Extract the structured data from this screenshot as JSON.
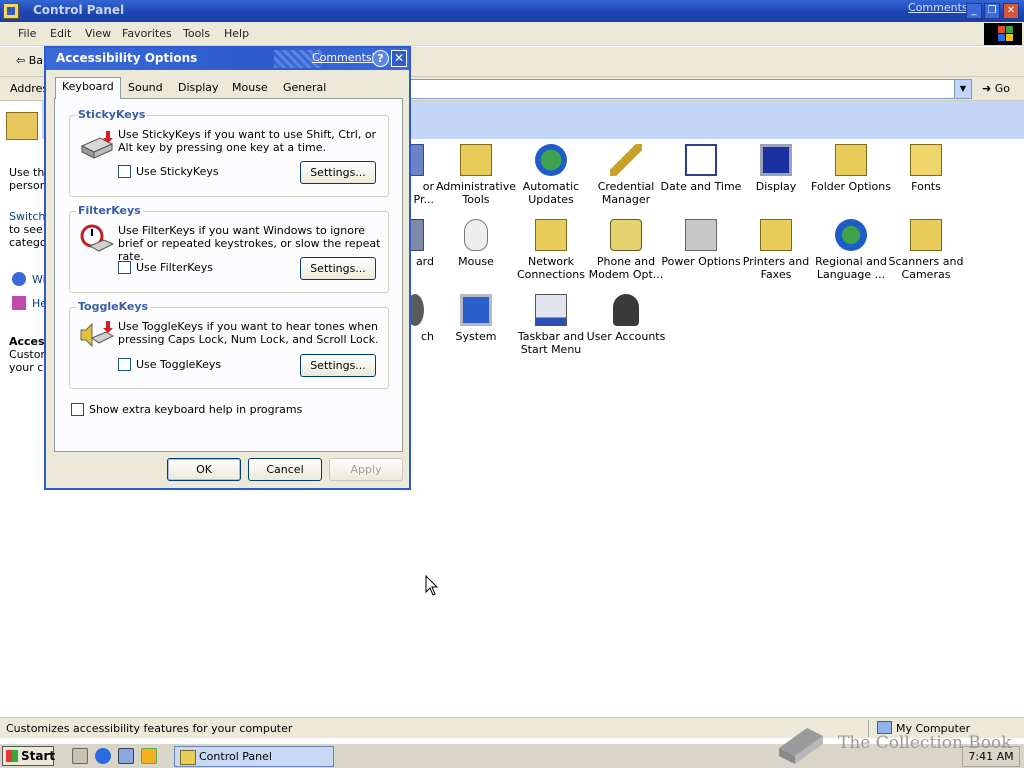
{
  "main_window": {
    "title": "Control Panel",
    "comments_link": "Comments?",
    "minimize": "_",
    "restore": "❐",
    "close": "✕"
  },
  "menu": [
    "File",
    "Edit",
    "View",
    "Favorites",
    "Tools",
    "Help"
  ],
  "toolbar": {
    "back_label": "Ba"
  },
  "address": {
    "label": "Addres",
    "go_label": "Go"
  },
  "left_panel": {
    "line1": "Use the",
    "line2": "person",
    "switch": "Switch",
    "to_see": "to see i",
    "category": "categor",
    "item1": "Wi",
    "item2": "He",
    "access_title": "Acces",
    "custom": "Custom",
    "your": "your co"
  },
  "icons_row1": [
    {
      "l1": "or",
      "l2": "Pr...",
      "name": "cut-off"
    },
    {
      "l1": "Administrative",
      "l2": "Tools"
    },
    {
      "l1": "Automatic",
      "l2": "Updates"
    },
    {
      "l1": "Credential",
      "l2": "Manager"
    },
    {
      "l1": "Date and Time",
      "l2": ""
    },
    {
      "l1": "Display",
      "l2": ""
    },
    {
      "l1": "Folder Options",
      "l2": ""
    },
    {
      "l1": "Fonts",
      "l2": ""
    }
  ],
  "icons_row2": [
    {
      "l1": "ard",
      "l2": ""
    },
    {
      "l1": "Mouse",
      "l2": ""
    },
    {
      "l1": "Network",
      "l2": "Connections"
    },
    {
      "l1": "Phone and",
      "l2": "Modem Opt..."
    },
    {
      "l1": "Power Options",
      "l2": ""
    },
    {
      "l1": "Printers and",
      "l2": "Faxes"
    },
    {
      "l1": "Regional and",
      "l2": "Language ..."
    },
    {
      "l1": "Scanners and",
      "l2": "Cameras"
    }
  ],
  "icons_row3": [
    {
      "l1": "ch",
      "l2": ""
    },
    {
      "l1": "System",
      "l2": ""
    },
    {
      "l1": "Taskbar and",
      "l2": "Start Menu"
    },
    {
      "l1": "User Accounts",
      "l2": ""
    }
  ],
  "dialog": {
    "title": "Accessibility Options",
    "comments": "Comments?",
    "help": "?",
    "close": "✕",
    "tabs": [
      "Keyboard",
      "Sound",
      "Display",
      "Mouse",
      "General"
    ],
    "stickykeys": {
      "title": "StickyKeys",
      "desc": "Use StickyKeys if you want to use Shift, Ctrl, or Alt key by pressing one key at a time.",
      "checkbox": "Use StickyKeys",
      "settings": "Settings..."
    },
    "filterkeys": {
      "title": "FilterKeys",
      "desc": "Use FilterKeys if you want Windows to ignore brief or repeated keystrokes, or slow the repeat rate.",
      "checkbox": "Use FilterKeys",
      "settings": "Settings..."
    },
    "togglekeys": {
      "title": "ToggleKeys",
      "desc": "Use ToggleKeys if you want to hear tones when pressing Caps Lock, Num Lock, and Scroll Lock.",
      "checkbox": "Use ToggleKeys",
      "settings": "Settings..."
    },
    "extra_help": "Show extra keyboard help in programs",
    "ok": "OK",
    "cancel": "Cancel",
    "apply": "Apply"
  },
  "status_bar": {
    "text": "Customizes accessibility features for your computer",
    "zone": "My Computer"
  },
  "taskbar": {
    "start": "Start",
    "task": "Control Panel",
    "clock": "7:41 AM"
  },
  "watermark": "The Collection Book"
}
